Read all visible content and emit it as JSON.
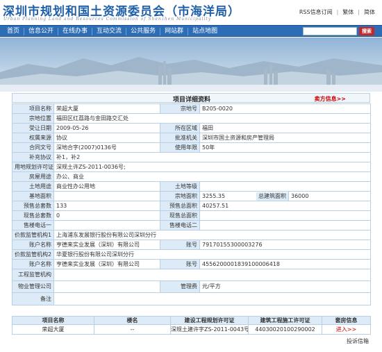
{
  "header": {
    "title": "深圳市规划和国土资源委员会（市海洋局）",
    "subtitle": "Urban Planning Land and Resources Commission of Shenzhen Municipality",
    "toplinks": [
      "RSS信息订阅",
      "繁体",
      "简体"
    ]
  },
  "nav": {
    "items": [
      "首页",
      "信息公开",
      "在线办事",
      "互动交流",
      "公共服务",
      "网站群",
      "站点地图"
    ],
    "search_button": "搜索"
  },
  "panel": {
    "title": "项目详细资料",
    "link": "卖方信息>>"
  },
  "detail": {
    "project_name_label": "项目名称",
    "project_name": "荣超大厦",
    "lot_no_label": "宗地号",
    "lot_no": "B205-0020",
    "lot_location_label": "宗地位置",
    "lot_location": "福田区红荔路与金田路交汇处",
    "accept_date_label": "受让日期",
    "accept_date": "2009-05-26",
    "district_label": "所在区域",
    "district": "福田",
    "ownership_label": "权属来源",
    "ownership": "协议",
    "approval_label": "批准机关",
    "approval": "深圳市国土资源和房产管理局",
    "contract_label": "合同文号",
    "contract": "深地合字(2007)0136号",
    "years_label": "使用年限",
    "years": "50年",
    "supplement_label": "补充协议",
    "supplement": "补1，补2",
    "permit_label": "用地规划许可证",
    "permit": "深规土许ZS-2011-0036号;",
    "house_use_label": "房屋用途",
    "house_use": "办公、商业",
    "land_use_label": "土地用途",
    "land_use": "商业性办公用地",
    "land_grade_label": "土地等级",
    "land_grade": "",
    "base_area_label": "基地面积",
    "base_area": "",
    "lot_area_label": "宗地面积",
    "lot_area": "3255.35",
    "total_build_label": "总建筑面积",
    "total_build": "36000",
    "presale_sets_label": "预售总套数",
    "presale_sets": "133",
    "presale_area_label": "预售总面积",
    "presale_area": "40257.51",
    "current_sets_label": "现售总套数",
    "current_sets": "0",
    "current_area_label": "现售总面积",
    "current_area": "",
    "phone1_label": "售楼电话一",
    "phone1": "",
    "phone2_label": "售楼电话二",
    "phone2": "",
    "supervisor1_label": "价款监管机构1",
    "supervisor1": "上海浦东发展银行股份有限公司深圳分行",
    "account_name1_label": "账户名称",
    "account_name1": "亨德来实业发展（深圳）有限公司",
    "account_no1_label": "账号",
    "account_no1": "79170155300003276",
    "supervisor2_label": "价款监管机构2",
    "supervisor2": "华夏银行股份有限公司深圳分行",
    "account_name2_label": "账户名称",
    "account_name2": "亨德来实业发展（深圳）有限公司",
    "account_no2_label": "账号",
    "account_no2": "4556200001839100006418",
    "eng_supervisor_label": "工程监管机构",
    "eng_supervisor": "",
    "property_co_label": "物业管理公司",
    "property_co": "",
    "mgmt_fee_label": "管理费",
    "mgmt_fee": "元/平方",
    "remark_label": "备注",
    "remark": ""
  },
  "projects": {
    "headers": [
      "项目名称",
      "楼名",
      "建设工程规划许可证",
      "建筑工程施工许可证",
      "套房信息"
    ],
    "rows": [
      {
        "name": "荣超大厦",
        "building": "--",
        "plan_permit": "深规土建许字ZS-2011-0043号",
        "build_permit": "44030020100290002",
        "units": "进入>>"
      }
    ]
  },
  "feedback": "投诉信箱",
  "colors": {
    "brand": "#1f5fa8",
    "nav": "#2d6db5",
    "label_bg": "#dcebf7",
    "border": "#b9cfe3",
    "link_red": "#c00"
  }
}
